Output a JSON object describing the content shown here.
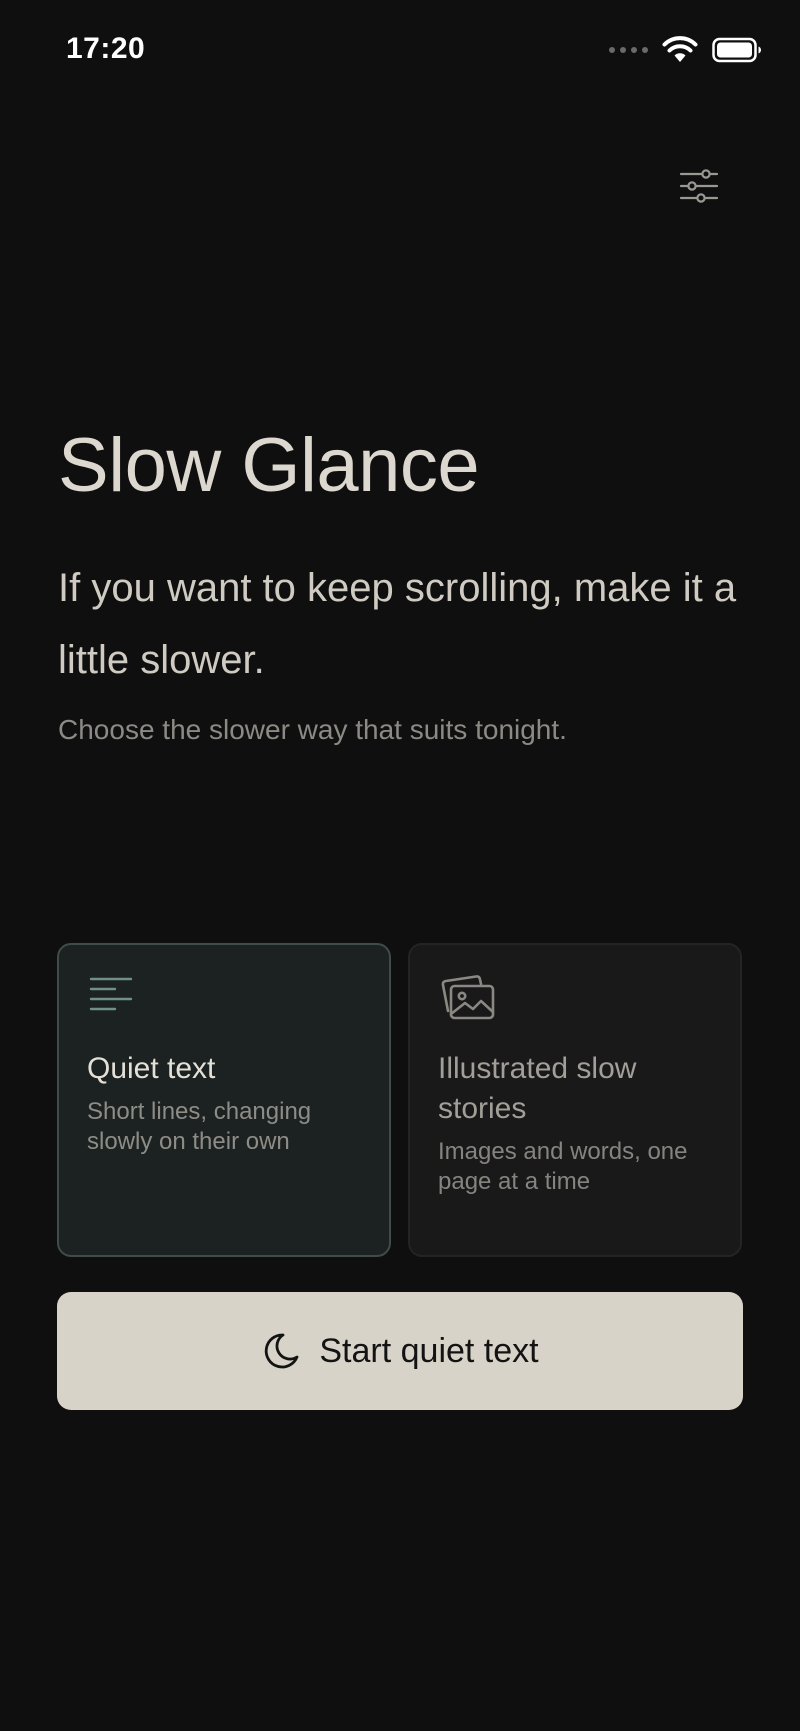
{
  "status_bar": {
    "time": "17:20"
  },
  "header": {
    "settings_icon": "sliders-icon"
  },
  "hero": {
    "title": "Slow Glance",
    "tagline": "If you want to keep scrolling, make it a little slower.",
    "subtext": "Choose the slower way that suits tonight."
  },
  "modes": [
    {
      "icon": "lines-icon",
      "title": "Quiet text",
      "description": "Short lines, changing slowly on their own",
      "selected": true
    },
    {
      "icon": "images-icon",
      "title": "Illustrated slow stories",
      "description": "Images and words, one page at a time",
      "selected": false
    }
  ],
  "start_button": {
    "icon": "moon-icon",
    "label": "Start quiet text"
  },
  "colors": {
    "background": "#0f0f0f",
    "text_primary": "#dcd8cf",
    "text_muted": "#8c8a85",
    "selected_card_bg": "#1c2221",
    "selected_card_border": "#3f4c49",
    "accent_icon": "#6f8f87",
    "button_bg": "#d7d3c8",
    "button_text": "#131313"
  }
}
